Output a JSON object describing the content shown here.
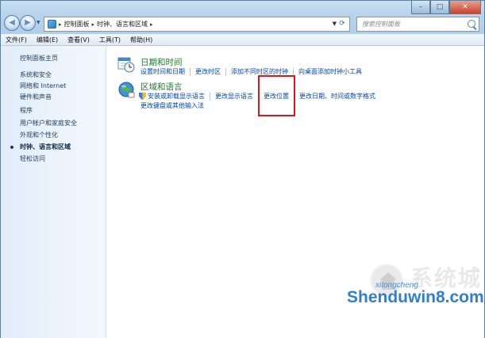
{
  "address_bar": {
    "breadcrumbs": [
      "控制面板",
      "时钟、语言和区域"
    ]
  },
  "search": {
    "placeholder": "搜索控制面板"
  },
  "window_controls": {
    "minimize": "–",
    "maximize": "□",
    "close": "✕"
  },
  "menu": [
    "文件(F)",
    "编辑(E)",
    "查看(V)",
    "工具(T)",
    "帮助(H)"
  ],
  "sidebar": {
    "items": [
      {
        "label": "控制面板主页"
      },
      {
        "label": "系统和安全"
      },
      {
        "label": "网络和 Internet"
      },
      {
        "label": "硬件和声音"
      },
      {
        "label": "程序"
      },
      {
        "label": "用户帐户和家庭安全"
      },
      {
        "label": "外观和个性化"
      },
      {
        "label": "时钟、语言和区域",
        "current": true
      },
      {
        "label": "轻松访问"
      }
    ]
  },
  "categories": {
    "datetime": {
      "title": "日期和时间",
      "links": [
        "设置时间和日期",
        "更改时区",
        "添加不同时区的时钟",
        "向桌面添加时钟小工具"
      ]
    },
    "region": {
      "title": "区域和语言",
      "links_row1": [
        "安装或卸载显示语言",
        "更改显示语言",
        "更改位置",
        "更改日期、时间或数字格式"
      ],
      "links_row2": [
        "更改键盘或其他输入法"
      ]
    }
  },
  "highlight": {
    "target": "更改位置",
    "color": "#d7191f"
  },
  "watermark": {
    "brand": "系统城",
    "site": "Shenduwin8.com",
    "sub": "xitongcheng"
  },
  "colors": {
    "link": "#0645ad",
    "category_title": "#1f7a2f"
  }
}
